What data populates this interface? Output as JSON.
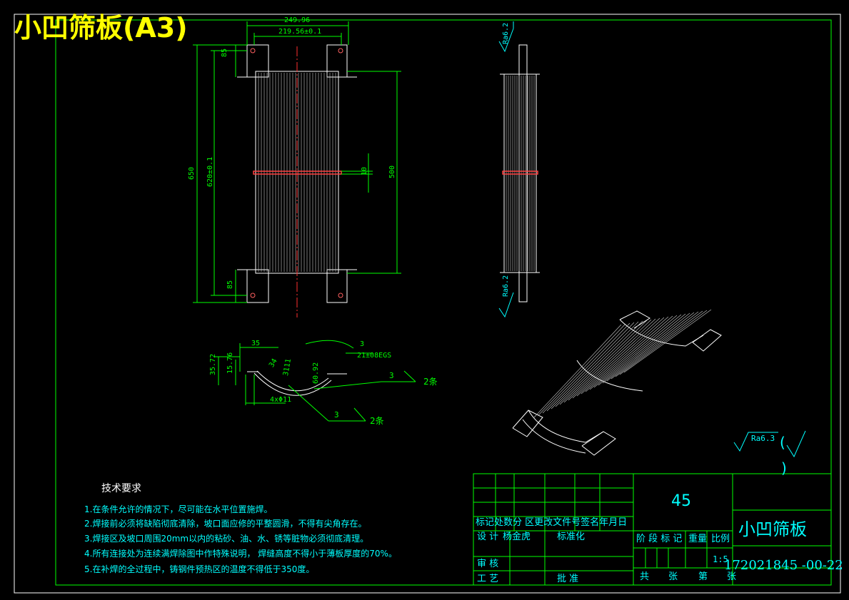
{
  "sheet_title": "小凹筛板(A3)",
  "dimensions": {
    "top_overall": "249.96",
    "top_inner": "219.56±0.1",
    "left_small": "85",
    "left_overall": "650",
    "left_inner": "620±0.1",
    "left_bottom_small": "85",
    "right_overall": "500",
    "center_gap": "10",
    "ra_side_top": "Ra6.2",
    "ra_side_bottom": "Ra6.2"
  },
  "section_view": {
    "dim_35": "35",
    "dim_3572": "35.72",
    "dim_1576": "15.76",
    "dim_34": "34",
    "dim_3111": "3111",
    "dim_6092": "60.92",
    "dim_3_top": "3",
    "dim_21": "21±08EGS",
    "hole_label": "4xΦ11",
    "weld_size_a": "3",
    "weld_count_a": "2条",
    "weld_size_b": "3",
    "weld_count_b": "2条"
  },
  "surface_finish": {
    "label": "Ra6.3",
    "paren_open": "(",
    "paren_close": ")"
  },
  "tech_requirements": {
    "heading": "技术要求",
    "items": [
      "1.在条件允许的情况下，尽可能在水平位置施焊。",
      "2.焊接前必须将缺陷彻底清除，坡口面应修的平整圆滑，不得有尖角存在。",
      "3.焊接区及坡口周围20mm以内的粘砂、油、水、锈等脏物必须彻底清理。",
      "4.所有连接处为连续满焊除图中作特殊说明， 焊缝高度不得小于薄板厚度的70%。",
      "5.在补焊的全过程中，铸钢件预热区的温度不得低于350度。"
    ]
  },
  "title_block": {
    "material": "45",
    "part_name": "小凹筛板",
    "drawing_no": "172021845 -00-22",
    "scale": "1:5",
    "rev_header": "标记处数分 区更改文件号签名年月日",
    "design_label": "设 计",
    "designer": "杨金虎",
    "standardize_label": "标准化",
    "stage_label": "阶 段 标 记",
    "weight_label": "重量",
    "scale_label": "比例",
    "review_label": "审 核",
    "process_label": "工 艺",
    "approve_label": "批 准",
    "total_label": "共",
    "sheets_label": "张",
    "page_label": "第",
    "sheet_label": "张"
  }
}
